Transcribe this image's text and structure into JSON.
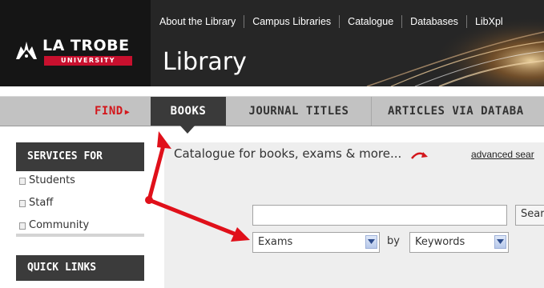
{
  "logo": {
    "line1": "LA TROBE",
    "line2": "UNIVERSITY"
  },
  "top_nav": [
    "About the Library",
    "Campus Libraries",
    "Catalogue",
    "Databases",
    "LibXpl"
  ],
  "site_title": "Library",
  "find_label": "FIND",
  "tabs": {
    "books": "BOOKS",
    "journals": "JOURNAL TITLES",
    "articles": "ARTICLES VIA DATABA"
  },
  "sidebar": {
    "services_heading": "SERVICES FOR",
    "items": [
      "Students",
      "Staff",
      "Community"
    ],
    "quick_links_heading": "QUICK LINKS"
  },
  "catalogue": {
    "heading": "Catalogue for books, exams & more...",
    "advanced_link": "advanced sear",
    "search_value": "",
    "search_button": "Sear",
    "scope_selected": "Exams",
    "by_label": "by",
    "field_selected": "Keywords"
  },
  "colors": {
    "accent_red": "#d3171c",
    "annotation_red": "#e0101a",
    "dark_bar": "#3b3b3b"
  }
}
